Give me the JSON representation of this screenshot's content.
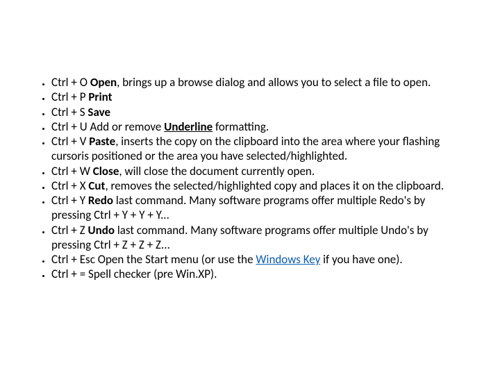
{
  "link_text": "Windows Key",
  "items": [
    {
      "segments": [
        {
          "t": "Ctrl + O "
        },
        {
          "t": "Open",
          "b": true
        },
        {
          "t": ", brings up a browse dialog and allows you to select a file to open."
        }
      ]
    },
    {
      "segments": [
        {
          "t": "Ctrl + P "
        },
        {
          "t": "Print",
          "b": true
        }
      ]
    },
    {
      "segments": [
        {
          "t": "Ctrl + S "
        },
        {
          "t": "Save",
          "b": true
        }
      ]
    },
    {
      "segments": [
        {
          "t": "Ctrl + U Add or remove "
        },
        {
          "t": "Underline",
          "b": true,
          "u": true
        },
        {
          "t": " formatting."
        }
      ]
    },
    {
      "segments": [
        {
          "t": "Ctrl + V "
        },
        {
          "t": "Paste",
          "b": true
        },
        {
          "t": ", inserts the copy on the clipboard into the area where your flashing cursoris positioned or the area you have selected/highlighted."
        }
      ]
    },
    {
      "segments": [
        {
          "t": "Ctrl + W "
        },
        {
          "t": "Close",
          "b": true
        },
        {
          "t": ", will close the document currently open."
        }
      ]
    },
    {
      "segments": [
        {
          "t": "Ctrl + X "
        },
        {
          "t": "Cut",
          "b": true
        },
        {
          "t": ", removes the selected/highlighted copy and places it on the clipboard."
        }
      ]
    },
    {
      "segments": [
        {
          "t": "Ctrl + Y "
        },
        {
          "t": "Redo",
          "b": true
        },
        {
          "t": " last command. Many software programs offer multiple Redo's by pressing Ctrl + Y + Y + Y..."
        }
      ]
    },
    {
      "segments": [
        {
          "t": "Ctrl + Z "
        },
        {
          "t": "Undo",
          "b": true
        },
        {
          "t": " last command. Many software programs offer multiple Undo's by pressing Ctrl + Z + Z + Z..."
        }
      ]
    },
    {
      "segments": [
        {
          "t": "Ctrl + Esc Open the Start menu (or use the "
        },
        {
          "t": "Windows Key",
          "link": true
        },
        {
          "t": " if you have one)."
        }
      ]
    },
    {
      "segments": [
        {
          "t": "Ctrl + = Spell checker (pre Win.XP)."
        }
      ]
    }
  ]
}
